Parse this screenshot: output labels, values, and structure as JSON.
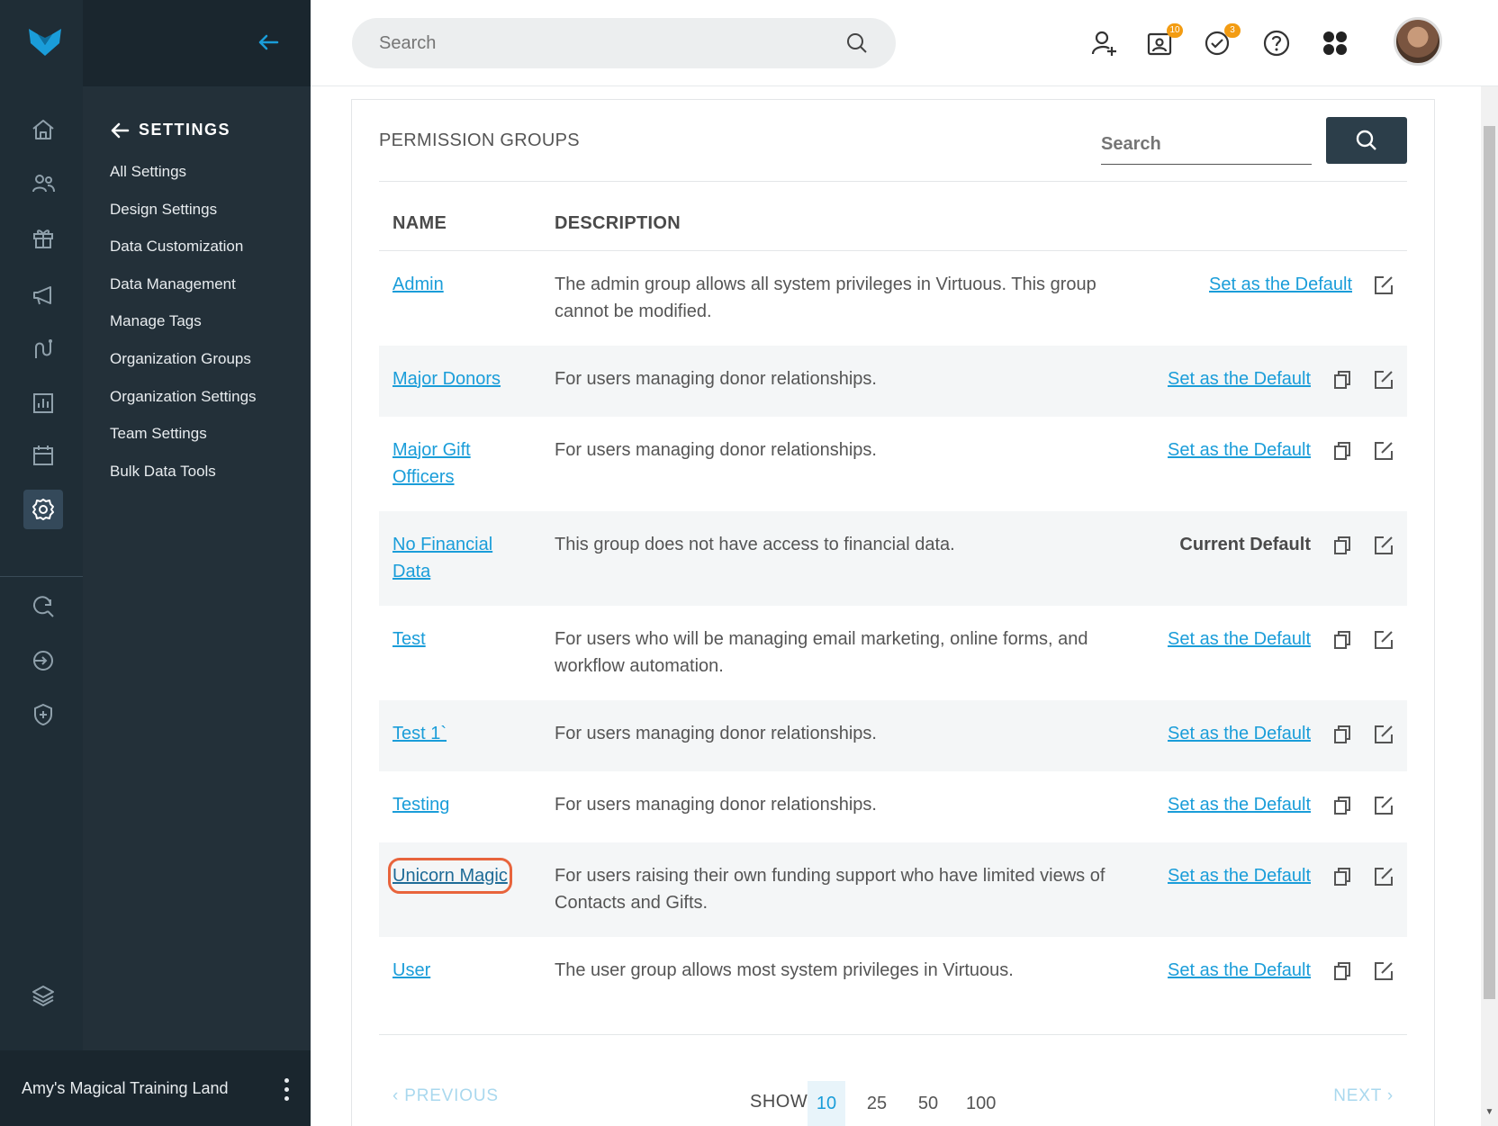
{
  "sidebar": {
    "nav_icons": [
      "home-icon",
      "contacts-icon",
      "gift-icon",
      "megaphone-icon",
      "workflow-icon",
      "reports-icon",
      "calendar-icon",
      "settings-icon",
      "search-refresh-icon",
      "import-icon",
      "shield-plus-icon",
      "layers-icon"
    ],
    "panel_title": "SETTINGS",
    "items": [
      "All Settings",
      "Design Settings",
      "Data Customization",
      "Data Management",
      "Manage Tags",
      "Organization Groups",
      "Organization Settings",
      "Team Settings",
      "Bulk Data Tools"
    ],
    "org_name": "Amy's Magical Training Land"
  },
  "header": {
    "search_placeholder": "Search",
    "badges": {
      "tasks": "10",
      "checks": "3"
    }
  },
  "card": {
    "title": "PERMISSION GROUPS",
    "search_placeholder": "Search",
    "columns": {
      "name": "NAME",
      "description": "DESCRIPTION"
    },
    "rows": [
      {
        "name": "Admin",
        "description": "The admin group allows all system privileges in Virtuous. This group cannot be modified.",
        "action": "Set as the Default"
      },
      {
        "name": "Major Donors",
        "description": "For users managing donor relationships.",
        "action": "Set as the Default"
      },
      {
        "name": "Major Gift Officers",
        "description": "For users managing donor relationships.",
        "action": "Set as the Default"
      },
      {
        "name": "No Financial Data",
        "description": "This group does not have access to financial data.",
        "action": "Current Default"
      },
      {
        "name": "Test",
        "description": "For users who will be managing email marketing, online forms, and workflow automation.",
        "action": "Set as the Default"
      },
      {
        "name": "Test 1`",
        "description": "For users managing donor relationships.",
        "action": "Set as the Default"
      },
      {
        "name": "Testing",
        "description": "For users managing donor relationships.",
        "action": "Set as the Default"
      },
      {
        "name": "Unicorn Magic",
        "description": "For users raising their own funding support who have limited views of Contacts and Gifts.",
        "action": "Set as the Default"
      },
      {
        "name": "User",
        "description": "The user group allows most system privileges in Virtuous.",
        "action": "Set as the Default"
      }
    ],
    "pager": {
      "previous": "PREVIOUS",
      "next": "NEXT",
      "show_label": "SHOW",
      "sizes": [
        "10",
        "25",
        "50",
        "100"
      ],
      "selected": "10"
    }
  },
  "colors": {
    "accent": "#1a9dd9",
    "sidebar": "#1f2d36",
    "highlight": "#e8643c"
  }
}
